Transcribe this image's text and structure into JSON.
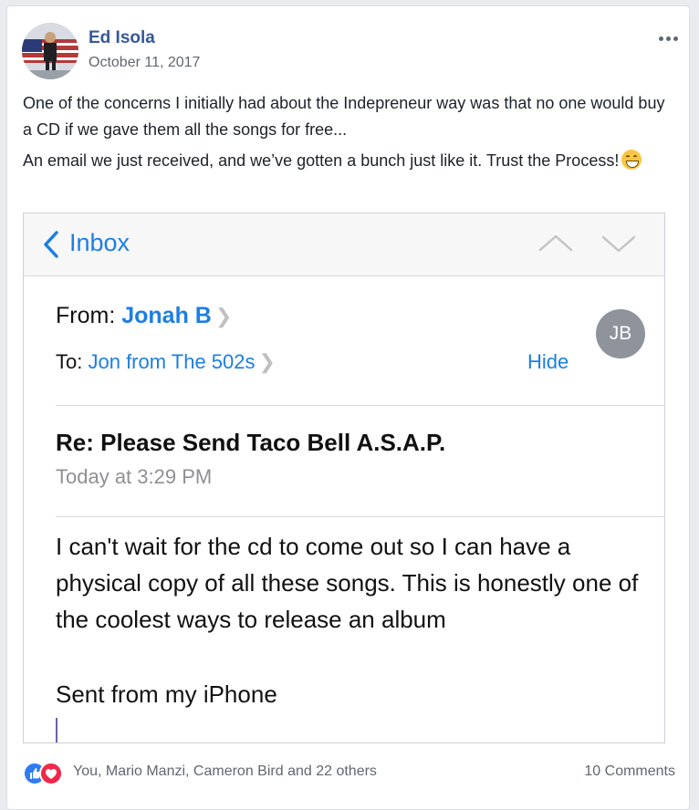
{
  "post": {
    "author": "Ed Isola",
    "date": "October 11, 2017",
    "paragraph1": "One of the concerns I initially had about the Indepreneur way was that no one would buy a CD if we gave them all the songs for free...",
    "paragraph2": "An email we just received, and we’ve gotten a bunch just like it. Trust the Process!",
    "emoji": "grinning-face-emoji"
  },
  "email": {
    "back_label": "Inbox",
    "from_label": "From:",
    "from_name": "Jonah B",
    "to_label": "To:",
    "to_name": "Jon from The 502s",
    "hide_label": "Hide",
    "avatar_initials": "JB",
    "subject": "Re: Please Send Taco Bell A.S.A.P.",
    "time": "Today at 3:29 PM",
    "body": "I can't wait for the cd to come out so I can have a physical copy of all these songs. This is honestly one of the coolest ways to release an album",
    "signature": "Sent from my iPhone"
  },
  "footer": {
    "reactions_text": "You, Mario Manzi, Cameron Bird and 22 others",
    "comments_text": "10 Comments"
  },
  "colors": {
    "facebook_link": "#365899",
    "ios_blue": "#1d7ee3",
    "like_blue": "#2e7bf3",
    "love_red": "#f0284a"
  }
}
